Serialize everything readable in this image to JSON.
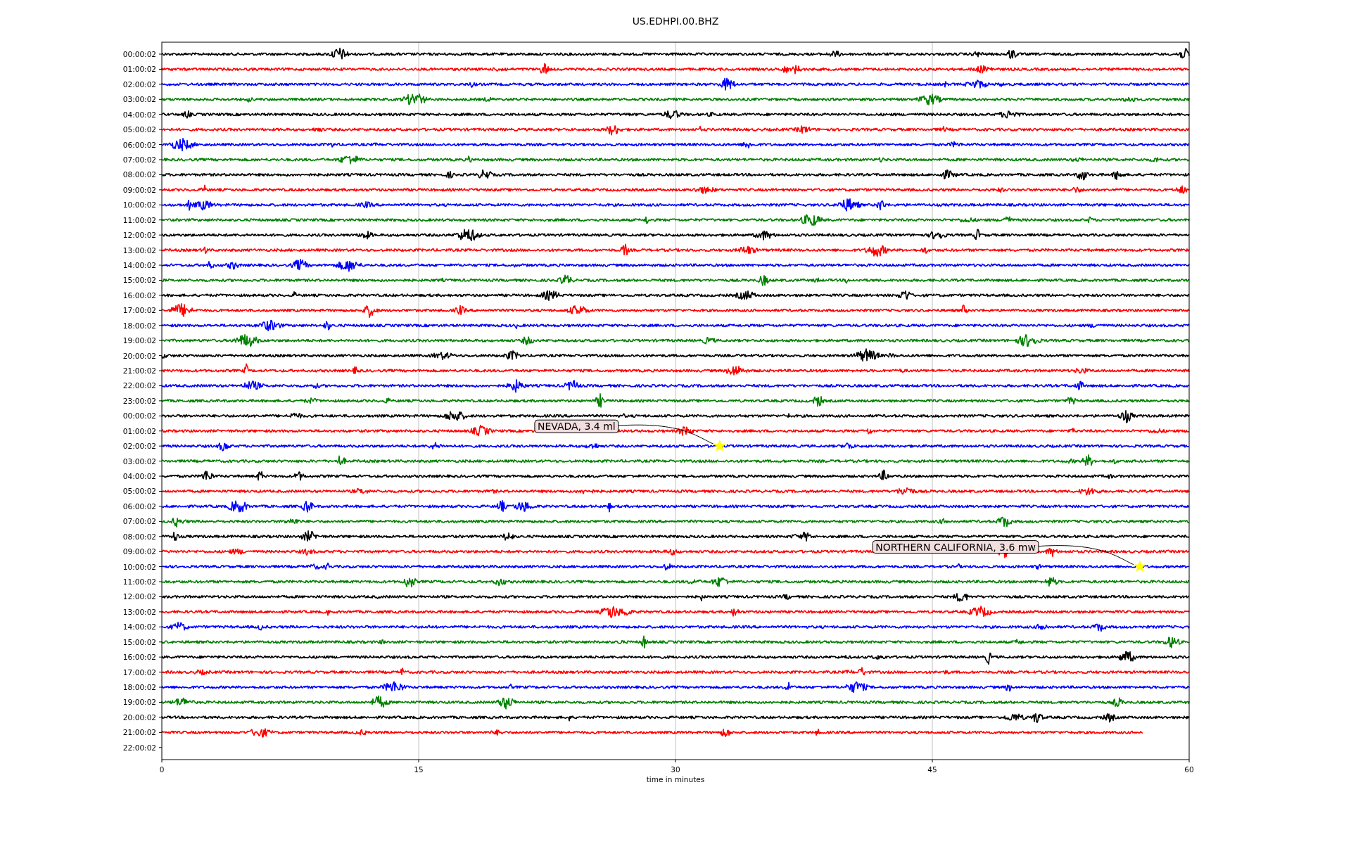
{
  "helicorder": {
    "title": "US.EDHPI.00.BHZ",
    "xlabel": "time in minutes",
    "x_ticks": [
      "0",
      "15",
      "30",
      "45",
      "60"
    ],
    "rows": [
      {
        "label": "00:00:02",
        "color": "#000000",
        "level": 1
      },
      {
        "label": "01:00:02",
        "color": "#ff0000",
        "level": 1
      },
      {
        "label": "02:00:02",
        "color": "#0000ff",
        "level": 1
      },
      {
        "label": "03:00:02",
        "color": "#008000",
        "level": 1
      },
      {
        "label": "04:00:02",
        "color": "#000000",
        "level": 1
      },
      {
        "label": "05:00:02",
        "color": "#ff0000",
        "level": 1
      },
      {
        "label": "06:00:02",
        "color": "#0000ff",
        "level": 1
      },
      {
        "label": "07:00:02",
        "color": "#008000",
        "level": 1
      },
      {
        "label": "08:00:02",
        "color": "#000000",
        "level": 1
      },
      {
        "label": "09:00:02",
        "color": "#ff0000",
        "level": 1
      },
      {
        "label": "10:00:02",
        "color": "#0000ff",
        "level": 1
      },
      {
        "label": "11:00:02",
        "color": "#008000",
        "level": 1
      },
      {
        "label": "12:00:02",
        "color": "#000000",
        "level": 1
      },
      {
        "label": "13:00:02",
        "color": "#ff0000",
        "level": 1
      },
      {
        "label": "14:00:02",
        "color": "#0000ff",
        "level": 1
      },
      {
        "label": "15:00:02",
        "color": "#008000",
        "level": 1
      },
      {
        "label": "16:00:02",
        "color": "#000000",
        "level": 1
      },
      {
        "label": "17:00:02",
        "color": "#ff0000",
        "level": 1
      },
      {
        "label": "18:00:02",
        "color": "#0000ff",
        "level": 1
      },
      {
        "label": "19:00:02",
        "color": "#008000",
        "level": 1
      },
      {
        "label": "20:00:02",
        "color": "#000000",
        "level": 1
      },
      {
        "label": "21:00:02",
        "color": "#ff0000",
        "level": 1
      },
      {
        "label": "22:00:02",
        "color": "#0000ff",
        "level": 1
      },
      {
        "label": "23:00:02",
        "color": "#008000",
        "level": 1
      },
      {
        "label": "00:00:02",
        "color": "#000000",
        "level": 1
      },
      {
        "label": "01:00:02",
        "color": "#ff0000",
        "level": 1
      },
      {
        "label": "02:00:02",
        "color": "#0000ff",
        "level": 1,
        "event": {
          "text": "NEVADA, 3.4 ml",
          "level": 0.543
        }
      },
      {
        "label": "03:00:02",
        "color": "#008000",
        "level": 1
      },
      {
        "label": "04:00:02",
        "color": "#000000",
        "level": 1
      },
      {
        "label": "05:00:02",
        "color": "#ff0000",
        "level": 1
      },
      {
        "label": "06:00:02",
        "color": "#0000ff",
        "level": 1
      },
      {
        "label": "07:00:02",
        "color": "#008000",
        "level": 1
      },
      {
        "label": "08:00:02",
        "color": "#000000",
        "level": 1
      },
      {
        "label": "09:00:02",
        "color": "#ff0000",
        "level": 1
      },
      {
        "label": "10:00:02",
        "color": "#0000ff",
        "level": 1,
        "event": {
          "text": "NORTHERN CALIFORNIA, 3.6 mw",
          "level": 0.952
        }
      },
      {
        "label": "11:00:02",
        "color": "#008000",
        "level": 1
      },
      {
        "label": "12:00:02",
        "color": "#000000",
        "level": 1
      },
      {
        "label": "13:00:02",
        "color": "#ff0000",
        "level": 1
      },
      {
        "label": "14:00:02",
        "color": "#0000ff",
        "level": 1
      },
      {
        "label": "15:00:02",
        "color": "#008000",
        "level": 1
      },
      {
        "label": "16:00:02",
        "color": "#000000",
        "level": 1
      },
      {
        "label": "17:00:02",
        "color": "#ff0000",
        "level": 1
      },
      {
        "label": "18:00:02",
        "color": "#0000ff",
        "level": 1
      },
      {
        "label": "19:00:02",
        "color": "#008000",
        "level": 1
      },
      {
        "label": "20:00:02",
        "color": "#000000",
        "level": 1
      },
      {
        "label": "21:00:02",
        "color": "#ff0000",
        "level": 0.955
      },
      {
        "label": "22:00:02"
      }
    ]
  }
}
